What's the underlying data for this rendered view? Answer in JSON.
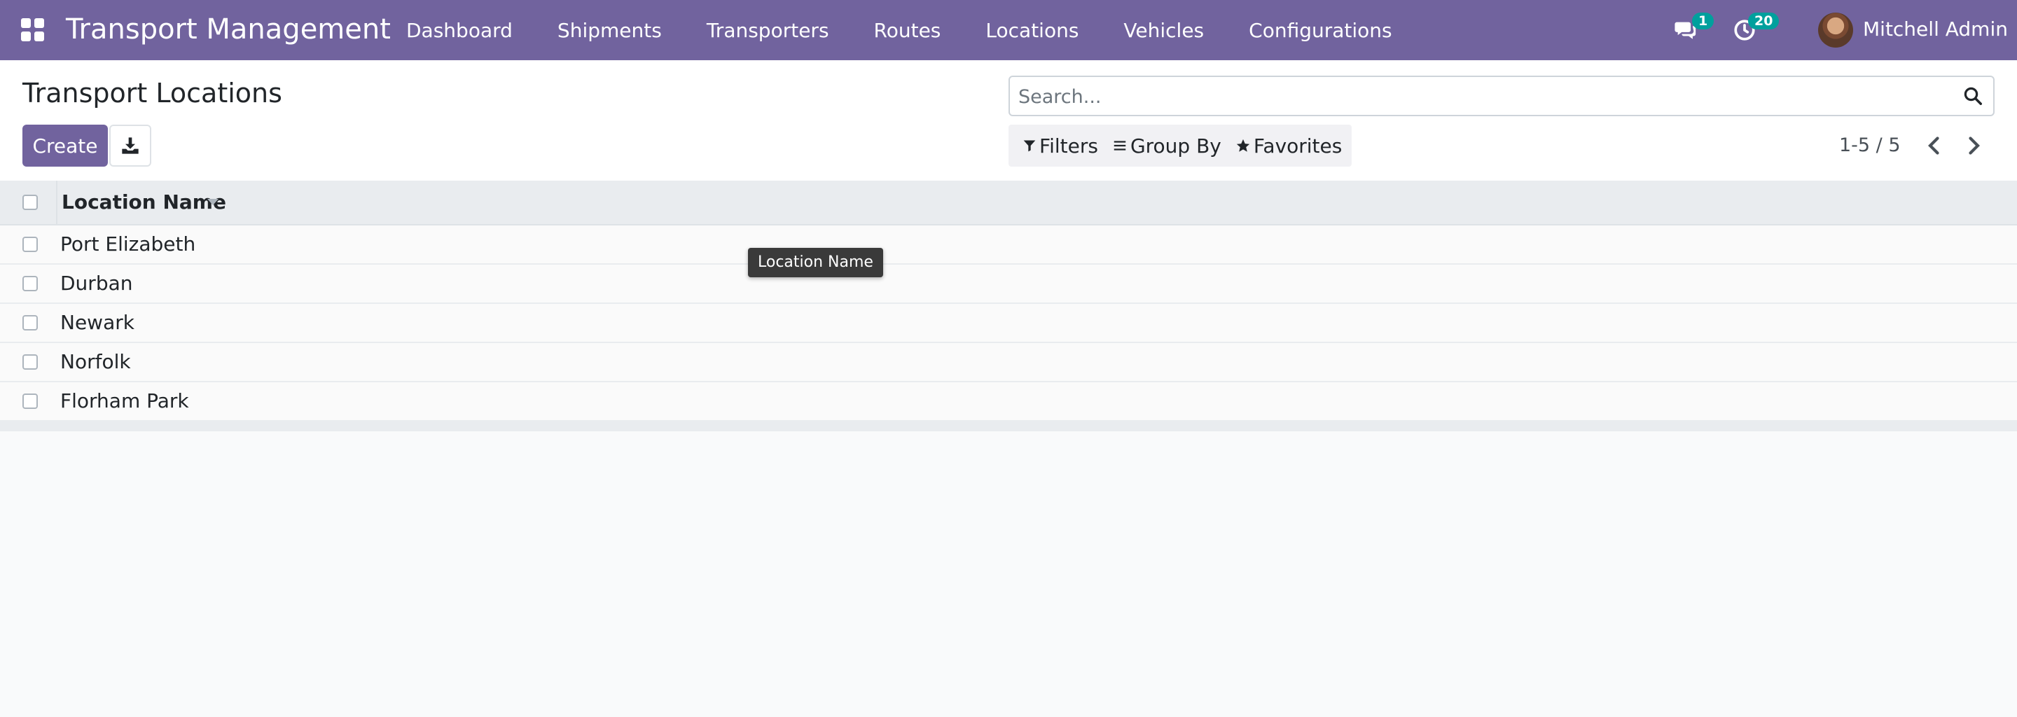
{
  "topbar": {
    "app_title": "Transport Management",
    "menu": [
      "Dashboard",
      "Shipments",
      "Transporters",
      "Routes",
      "Locations",
      "Vehicles",
      "Configurations"
    ],
    "messages_count": "1",
    "activities_count": "20",
    "user_name": "Mitchell Admin",
    "brand_color": "#71639e",
    "badge_color": "#00a09d"
  },
  "control": {
    "page_title": "Transport Locations",
    "create_label": "Create",
    "search_placeholder": "Search...",
    "filters_label": "Filters",
    "group_by_label": "Group By",
    "favorites_label": "Favorites",
    "pager_value": "1-5 / 5"
  },
  "list": {
    "column_header": "Location Name",
    "rows": [
      "Port Elizabeth",
      "Durban",
      "Newark",
      "Norfolk",
      "Florham Park"
    ]
  },
  "tooltip": {
    "text": "Location Name"
  }
}
